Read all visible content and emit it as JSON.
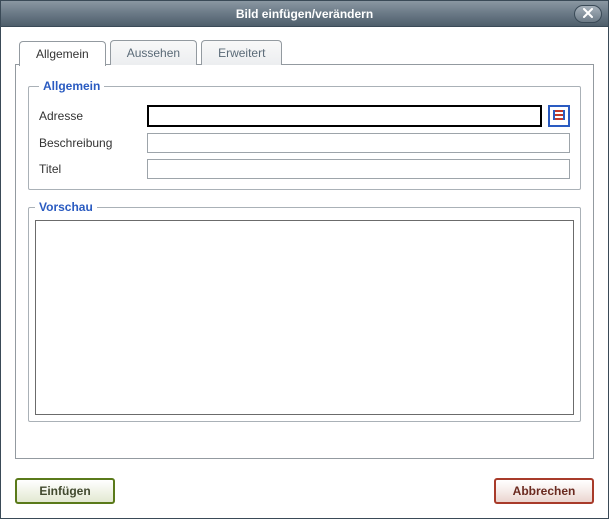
{
  "titlebar": {
    "title": "Bild einfügen/verändern"
  },
  "tabs": {
    "general": "Allgemein",
    "appearance": "Aussehen",
    "advanced": "Erweitert",
    "active": "general"
  },
  "general_group": {
    "legend": "Allgemein",
    "address_label": "Adresse",
    "address_value": "",
    "description_label": "Beschreibung",
    "description_value": "",
    "title_label": "Titel",
    "title_value": ""
  },
  "preview_group": {
    "legend": "Vorschau"
  },
  "footer": {
    "insert_label": "Einfügen",
    "cancel_label": "Abbrechen"
  },
  "icons": {
    "close": "close-icon",
    "browse": "browse-icon"
  },
  "colors": {
    "accent": "#2a5bc1",
    "cancel": "#a83b2a",
    "insert": "#5a7a1a"
  }
}
